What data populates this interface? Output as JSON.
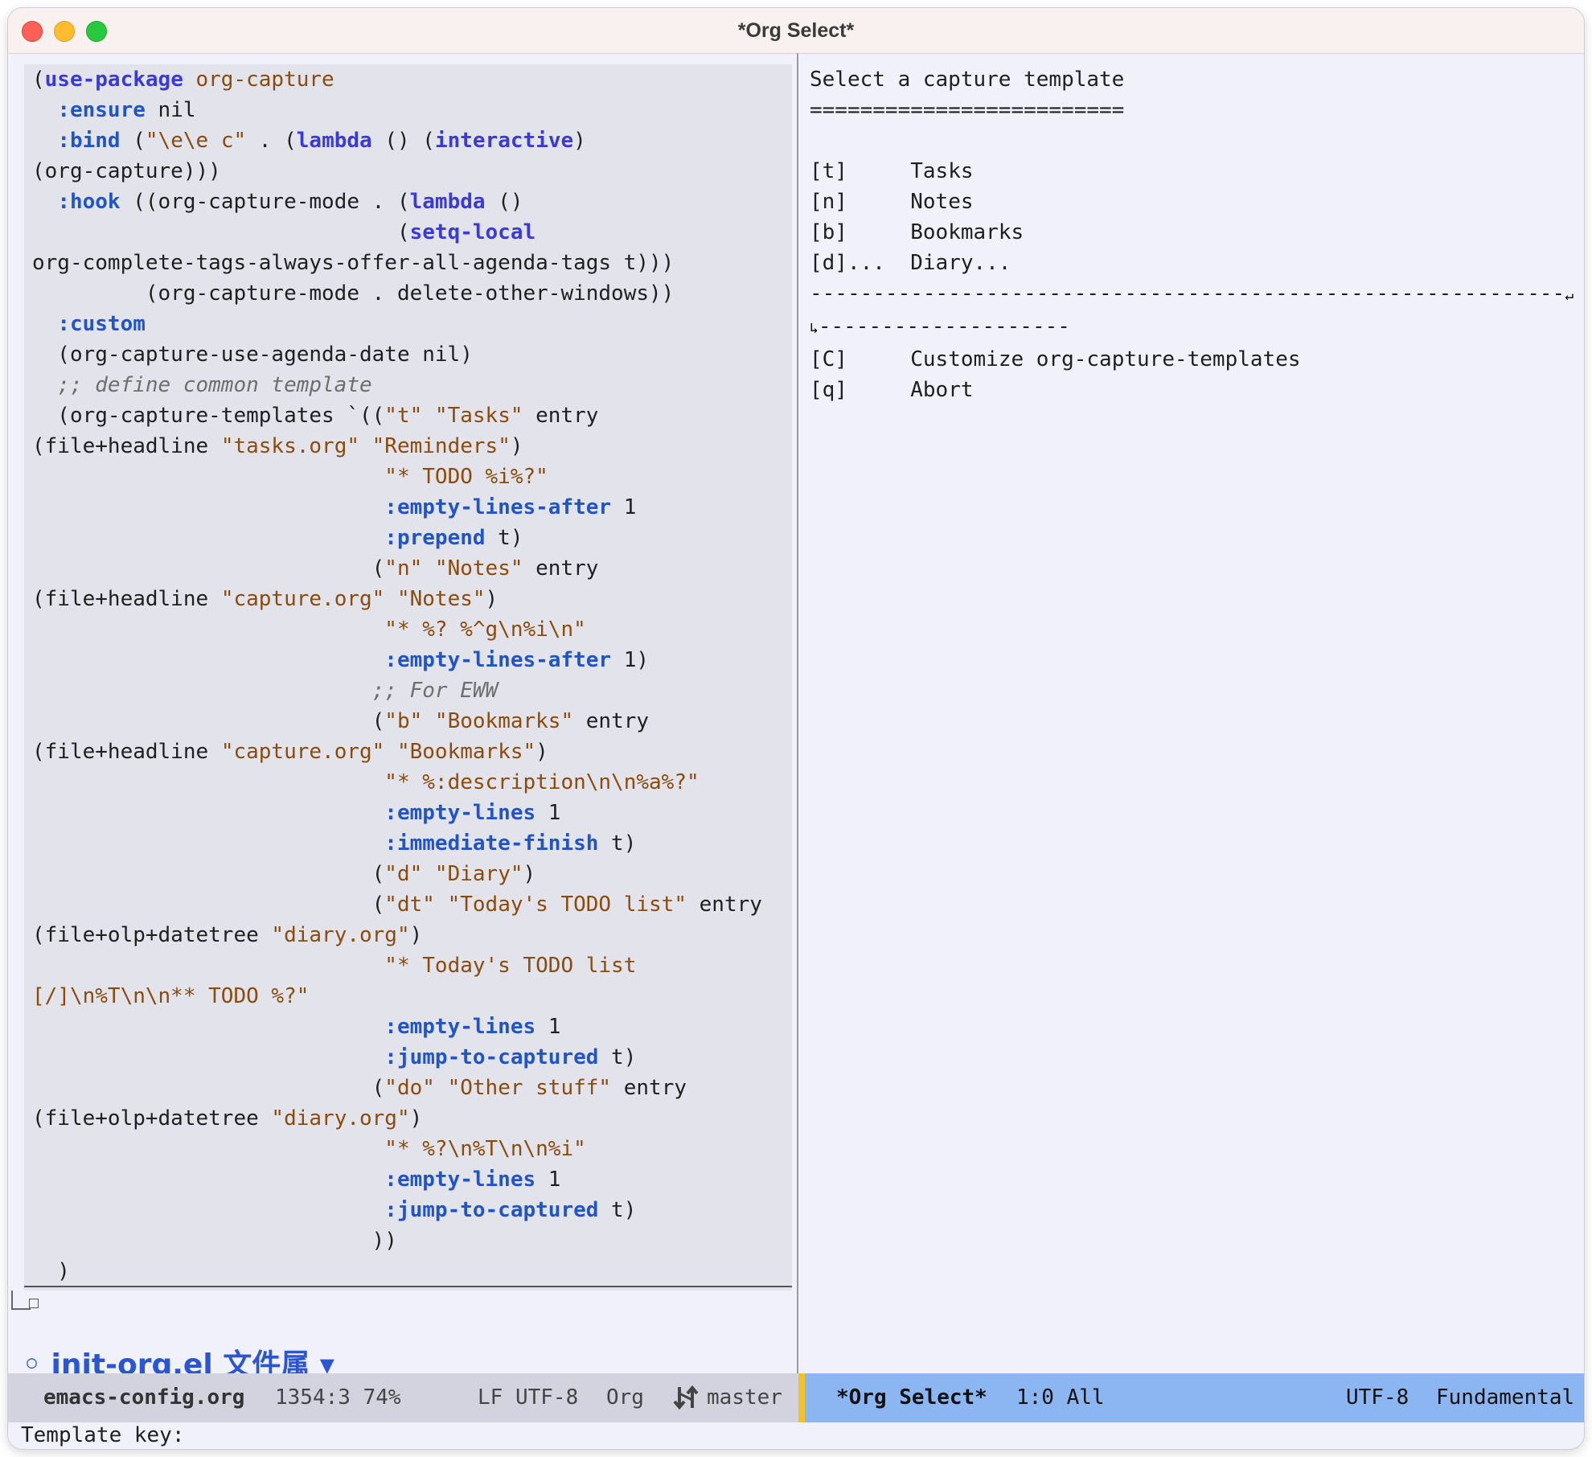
{
  "window": {
    "title": "*Org Select*"
  },
  "left_pane": {
    "lines": [
      [
        {
          "t": "(",
          "c": ""
        },
        {
          "t": "use-package",
          "c": "kw"
        },
        {
          "t": " org-capture",
          "c": "st"
        }
      ],
      [
        {
          "t": "  ",
          "c": ""
        },
        {
          "t": ":ensure",
          "c": "ky"
        },
        {
          "t": " nil",
          "c": ""
        }
      ],
      [
        {
          "t": "  ",
          "c": ""
        },
        {
          "t": ":bind",
          "c": "ky"
        },
        {
          "t": " (",
          "c": ""
        },
        {
          "t": "\"\\e\\e c\"",
          "c": "st"
        },
        {
          "t": " . (",
          "c": ""
        },
        {
          "t": "lambda",
          "c": "kw"
        },
        {
          "t": " () (",
          "c": ""
        },
        {
          "t": "interactive",
          "c": "kw"
        },
        {
          "t": ")",
          "c": ""
        }
      ],
      [
        {
          "t": "(org-capture)))",
          "c": ""
        }
      ],
      [
        {
          "t": "  ",
          "c": ""
        },
        {
          "t": ":hook",
          "c": "ky"
        },
        {
          "t": " ((org-capture-mode . (",
          "c": ""
        },
        {
          "t": "lambda",
          "c": "kw"
        },
        {
          "t": " ()",
          "c": ""
        }
      ],
      [
        {
          "t": "                             (",
          "c": ""
        },
        {
          "t": "setq-local",
          "c": "kw"
        }
      ],
      [
        {
          "t": "org-complete-tags-always-offer-all-agenda-tags t)))",
          "c": ""
        }
      ],
      [
        {
          "t": "         (org-capture-mode . delete-other-windows))",
          "c": ""
        }
      ],
      [
        {
          "t": "  ",
          "c": ""
        },
        {
          "t": ":custom",
          "c": "ky"
        }
      ],
      [
        {
          "t": "  (org-capture-use-agenda-date nil)",
          "c": ""
        }
      ],
      [
        {
          "t": "  ;; define common template",
          "c": "cm"
        }
      ],
      [
        {
          "t": "  (org-capture-templates `((",
          "c": ""
        },
        {
          "t": "\"t\"",
          "c": "st"
        },
        {
          "t": " ",
          "c": ""
        },
        {
          "t": "\"Tasks\"",
          "c": "st"
        },
        {
          "t": " entry",
          "c": ""
        }
      ],
      [
        {
          "t": "(file+headline ",
          "c": ""
        },
        {
          "t": "\"tasks.org\"",
          "c": "st"
        },
        {
          "t": " ",
          "c": ""
        },
        {
          "t": "\"Reminders\"",
          "c": "st"
        },
        {
          "t": ")",
          "c": ""
        }
      ],
      [
        {
          "t": "                            ",
          "c": ""
        },
        {
          "t": "\"* TODO %i%?\"",
          "c": "st"
        }
      ],
      [
        {
          "t": "                            ",
          "c": ""
        },
        {
          "t": ":empty-lines-after",
          "c": "ky"
        },
        {
          "t": " 1",
          "c": ""
        }
      ],
      [
        {
          "t": "                            ",
          "c": ""
        },
        {
          "t": ":prepend",
          "c": "ky"
        },
        {
          "t": " t)",
          "c": ""
        }
      ],
      [
        {
          "t": "                           (",
          "c": ""
        },
        {
          "t": "\"n\"",
          "c": "st"
        },
        {
          "t": " ",
          "c": ""
        },
        {
          "t": "\"Notes\"",
          "c": "st"
        },
        {
          "t": " entry",
          "c": ""
        }
      ],
      [
        {
          "t": "(file+headline ",
          "c": ""
        },
        {
          "t": "\"capture.org\"",
          "c": "st"
        },
        {
          "t": " ",
          "c": ""
        },
        {
          "t": "\"Notes\"",
          "c": "st"
        },
        {
          "t": ")",
          "c": ""
        }
      ],
      [
        {
          "t": "                            ",
          "c": ""
        },
        {
          "t": "\"* %? %^g\\n%i\\n\"",
          "c": "st"
        }
      ],
      [
        {
          "t": "                            ",
          "c": ""
        },
        {
          "t": ":empty-lines-after",
          "c": "ky"
        },
        {
          "t": " 1)",
          "c": ""
        }
      ],
      [
        {
          "t": "                           ;; For EWW",
          "c": "cm"
        }
      ],
      [
        {
          "t": "                           (",
          "c": ""
        },
        {
          "t": "\"b\"",
          "c": "st"
        },
        {
          "t": " ",
          "c": ""
        },
        {
          "t": "\"Bookmarks\"",
          "c": "st"
        },
        {
          "t": " entry",
          "c": ""
        }
      ],
      [
        {
          "t": "(file+headline ",
          "c": ""
        },
        {
          "t": "\"capture.org\"",
          "c": "st"
        },
        {
          "t": " ",
          "c": ""
        },
        {
          "t": "\"Bookmarks\"",
          "c": "st"
        },
        {
          "t": ")",
          "c": ""
        }
      ],
      [
        {
          "t": "                            ",
          "c": ""
        },
        {
          "t": "\"* %:description\\n\\n%a%?\"",
          "c": "st"
        }
      ],
      [
        {
          "t": "                            ",
          "c": ""
        },
        {
          "t": ":empty-lines",
          "c": "ky"
        },
        {
          "t": " 1",
          "c": ""
        }
      ],
      [
        {
          "t": "                            ",
          "c": ""
        },
        {
          "t": ":immediate-finish",
          "c": "ky"
        },
        {
          "t": " t)",
          "c": ""
        }
      ],
      [
        {
          "t": "                           (",
          "c": ""
        },
        {
          "t": "\"d\"",
          "c": "st"
        },
        {
          "t": " ",
          "c": ""
        },
        {
          "t": "\"Diary\"",
          "c": "st"
        },
        {
          "t": ")",
          "c": ""
        }
      ],
      [
        {
          "t": "                           (",
          "c": ""
        },
        {
          "t": "\"dt\"",
          "c": "st"
        },
        {
          "t": " ",
          "c": ""
        },
        {
          "t": "\"Today's TODO list\"",
          "c": "st"
        },
        {
          "t": " entry",
          "c": ""
        }
      ],
      [
        {
          "t": "(file+olp+datetree ",
          "c": ""
        },
        {
          "t": "\"diary.org\"",
          "c": "st"
        },
        {
          "t": ")",
          "c": ""
        }
      ],
      [
        {
          "t": "                            ",
          "c": ""
        },
        {
          "t": "\"* Today's TODO list",
          "c": "st"
        }
      ],
      [
        {
          "t": "[/]\\n%T\\n\\n** TODO %?\"",
          "c": "st"
        }
      ],
      [
        {
          "t": "                            ",
          "c": ""
        },
        {
          "t": ":empty-lines",
          "c": "ky"
        },
        {
          "t": " 1",
          "c": ""
        }
      ],
      [
        {
          "t": "                            ",
          "c": ""
        },
        {
          "t": ":jump-to-captured",
          "c": "ky"
        },
        {
          "t": " t)",
          "c": ""
        }
      ],
      [
        {
          "t": "                           (",
          "c": ""
        },
        {
          "t": "\"do\"",
          "c": "st"
        },
        {
          "t": " ",
          "c": ""
        },
        {
          "t": "\"Other stuff\"",
          "c": "st"
        },
        {
          "t": " entry",
          "c": ""
        }
      ],
      [
        {
          "t": "(file+olp+datetree ",
          "c": ""
        },
        {
          "t": "\"diary.org\"",
          "c": "st"
        },
        {
          "t": ")",
          "c": ""
        }
      ],
      [
        {
          "t": "                            ",
          "c": ""
        },
        {
          "t": "\"* %?\\n%T\\n\\n%i\"",
          "c": "st"
        }
      ],
      [
        {
          "t": "                            ",
          "c": ""
        },
        {
          "t": ":empty-lines",
          "c": "ky"
        },
        {
          "t": " 1",
          "c": ""
        }
      ],
      [
        {
          "t": "                            ",
          "c": ""
        },
        {
          "t": ":jump-to-captured",
          "c": "ky"
        },
        {
          "t": " t)",
          "c": ""
        }
      ],
      [
        {
          "t": "                           ))",
          "c": ""
        }
      ],
      [
        {
          "t": "  )",
          "c": ""
        }
      ]
    ],
    "partial_heading": "◦ init-org.el 文件属 ▾"
  },
  "right_pane": {
    "header": "Select a capture template",
    "underline": "=========================",
    "templates": [
      {
        "key": "[t]",
        "label": "Tasks"
      },
      {
        "key": "[n]",
        "label": "Notes"
      },
      {
        "key": "[b]",
        "label": "Bookmarks"
      },
      {
        "key": "[d]...",
        "label": "Diary..."
      }
    ],
    "separator_1": "------------------------------------------------------------",
    "separator_2": "--------------------",
    "actions": [
      {
        "key": "[C]",
        "label": "Customize org-capture-templates"
      },
      {
        "key": "[q]",
        "label": "Abort"
      }
    ]
  },
  "modeline_left": {
    "buffer": "emacs-config.org",
    "position": "1354:3 74%",
    "encoding": "LF UTF-8",
    "mode": "Org",
    "branch": "master",
    "branch_icon": "git-branch-icon"
  },
  "modeline_right": {
    "buffer": "*Org Select*",
    "position": "1:0 All",
    "encoding": "UTF-8",
    "mode": "Fundamental"
  },
  "minibuffer": {
    "prompt": "Template key:"
  },
  "colors": {
    "keyword": "#3a3ad6",
    "keyword_arg": "#2154c4",
    "string": "#8a4b0c",
    "comment": "#6e6e6e",
    "modeline_active": "#8cb6f2",
    "modeline_inactive": "#d2d3de",
    "accent": "#f2c12e"
  }
}
